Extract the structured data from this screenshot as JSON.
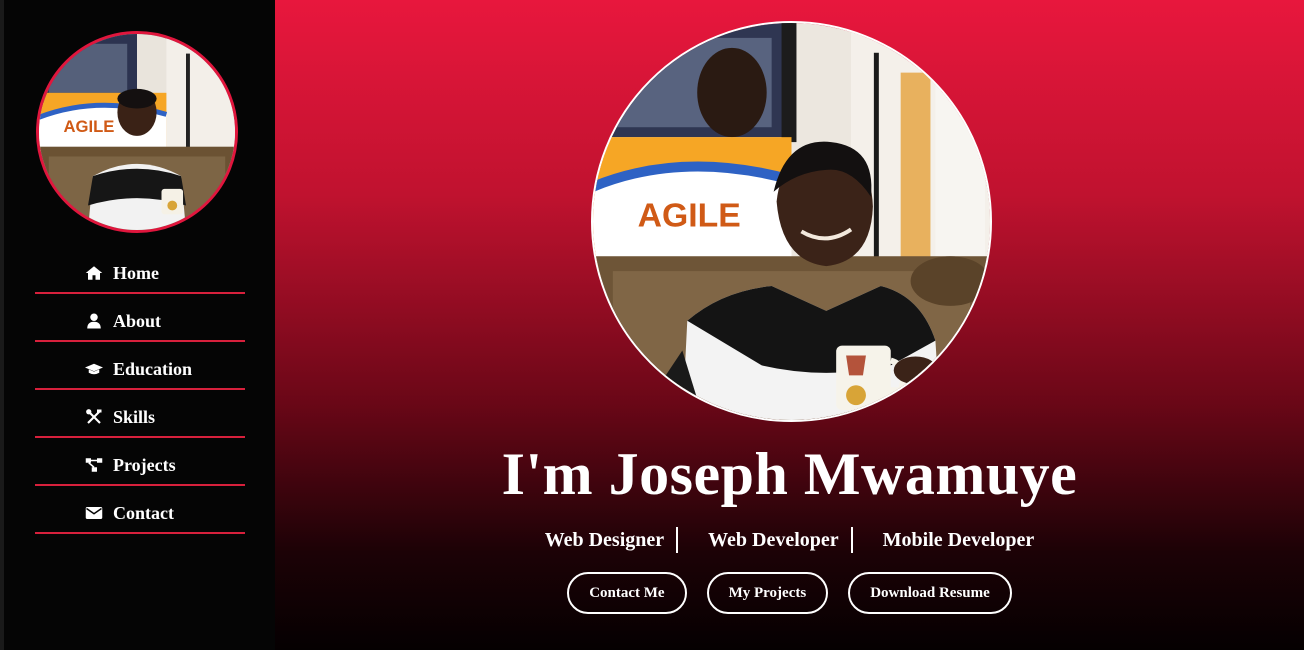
{
  "sidebar": {
    "nav": [
      {
        "label": "Home",
        "icon": "home-icon"
      },
      {
        "label": "About",
        "icon": "user-icon"
      },
      {
        "label": "Education",
        "icon": "graduation-cap-icon"
      },
      {
        "label": "Skills",
        "icon": "tools-icon"
      },
      {
        "label": "Projects",
        "icon": "project-diagram-icon"
      },
      {
        "label": "Contact",
        "icon": "envelope-icon"
      }
    ]
  },
  "hero": {
    "title": "I'm Joseph Mwamuye",
    "roles": [
      "Web Designer",
      "Web Developer",
      "Mobile Developer"
    ],
    "buttons": {
      "contact": "Contact Me",
      "projects": "My Projects",
      "resume": "Download Resume"
    },
    "photo_banner_text": "AGILE"
  },
  "colors": {
    "accent": "#e0163d",
    "sidebar_bg": "#050505",
    "gradient_top": "#e8173d",
    "gradient_bottom": "#050001"
  }
}
